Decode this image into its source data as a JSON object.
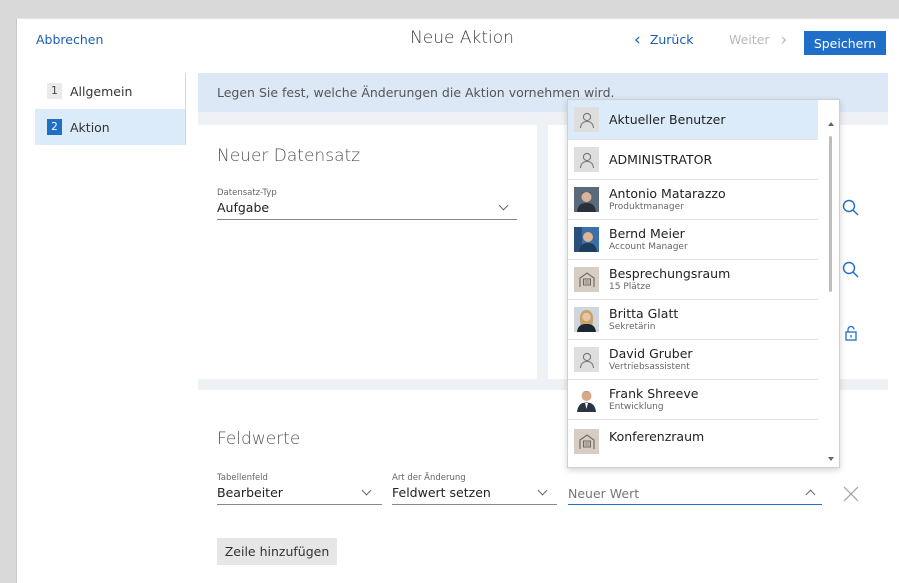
{
  "header": {
    "cancel_label": "Abbrechen",
    "title": "Neue Aktion",
    "back_label": "Zurück",
    "next_label": "Weiter",
    "save_label": "Speichern"
  },
  "sidebar": {
    "items": [
      {
        "num": "1",
        "label": "Allgemein",
        "active": false
      },
      {
        "num": "2",
        "label": "Aktion",
        "active": true
      }
    ]
  },
  "info_bar": {
    "text": "Legen Sie fest, welche Änderungen die Aktion vornehmen wird."
  },
  "new_record": {
    "title": "Neuer Datensatz",
    "type_label": "Datensatz-Typ",
    "type_value": "Aufgabe"
  },
  "field_values": {
    "title": "Feldwerte",
    "table_field_label": "Tabellenfeld",
    "table_field_value": "Bearbeiter",
    "change_type_label": "Art der Änderung",
    "change_type_value": "Feldwert setzen",
    "new_value_placeholder": "Neuer Wert",
    "add_row_label": "Zeile hinzufügen"
  },
  "dropdown": {
    "items": [
      {
        "name": "Aktueller Benutzer",
        "subtitle": "",
        "avatar": "person-icon"
      },
      {
        "name": "ADMINISTRATOR",
        "subtitle": "",
        "avatar": "person-icon"
      },
      {
        "name": "Antonio Matarazzo",
        "subtitle": "Produktmanager",
        "avatar": "photo"
      },
      {
        "name": "Bernd Meier",
        "subtitle": "Account Manager",
        "avatar": "photo"
      },
      {
        "name": "Besprechungsraum",
        "subtitle": "15 Plätze",
        "avatar": "room-icon"
      },
      {
        "name": "Britta Glatt",
        "subtitle": "Sekretärin",
        "avatar": "photo"
      },
      {
        "name": "David Gruber",
        "subtitle": "Vertriebsassistent",
        "avatar": "person-icon"
      },
      {
        "name": "Frank Shreeve",
        "subtitle": "Entwicklung",
        "avatar": "photo"
      },
      {
        "name": "Konferenzraum",
        "subtitle": "",
        "avatar": "room-icon"
      }
    ]
  },
  "colors": {
    "accent": "#1f6ec8",
    "highlight": "#dcebfa",
    "info_bar": "#dce8f5",
    "content_bg": "#eef1f5"
  }
}
